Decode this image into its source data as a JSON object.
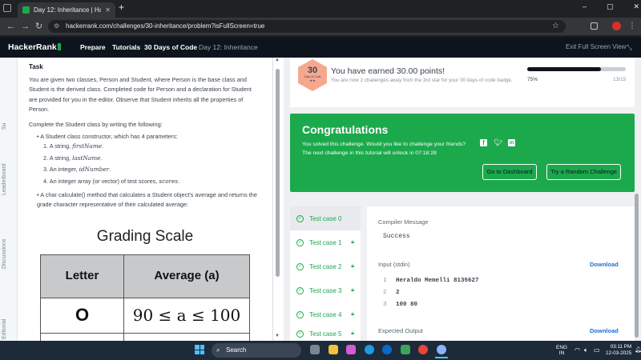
{
  "browser": {
    "tab_title": "Day 12: Inheritance | HackerRa...",
    "new_tab": "+",
    "url": "hackerrank.com/challenges/30-inheritance/problem?isFullScreen=true",
    "window_controls": [
      "–",
      "▢",
      "✕"
    ]
  },
  "header": {
    "logo": "HackerRank",
    "nav": [
      "Prepare",
      "Tutorials",
      "30 Days of Code"
    ],
    "breadcrumb": "Day 12: Inheritance",
    "exit_fullscreen": "Exit Full Screen View"
  },
  "left_rail": [
    "Su",
    "Leaderboard",
    "Discussions",
    "Editorial"
  ],
  "problem": {
    "heading": "Task",
    "para1": "You are given two classes, Person and Student, where Person is the base class and Student is the derived class. Completed code for Person and a declaration for Student are provided for you in the editor. Observe that Student inherits all the properties of Person.",
    "para2": "Complete the Student class by writing the following:",
    "bullet1": "A Student class constructor, which has 4 parameters:",
    "params": [
      {
        "prefix": "1. A string, ",
        "var": "firstName",
        "suffix": "."
      },
      {
        "prefix": "2. A string, ",
        "var": "lastName",
        "suffix": "."
      },
      {
        "prefix": "3. An integer, ",
        "var": "idNumber",
        "suffix": "."
      },
      {
        "prefix": "4. An integer array (or vector) of test scores, ",
        "var": "scores",
        "suffix": "."
      }
    ],
    "bullet2": "A char calculate() method that calculates a Student object's average and returns the grade character representative of their calculated average:",
    "grading_title": "Grading Scale",
    "table_headers": [
      "Letter",
      "Average (a)"
    ],
    "table_rows": [
      [
        "O",
        "90 ≤ a ≤ 100"
      ]
    ]
  },
  "score": {
    "badge_number": "30",
    "badge_label": "Days of Code",
    "badge_stars": "★★",
    "earned": "You have earned 30.00 points!",
    "sub": "You are now 2 challenges away from the 3rd star for your 30 days of code badge.",
    "progress_pct": "75%",
    "progress_value": 0.75,
    "progress_count": "13/15"
  },
  "congrats": {
    "title": "Congratulations",
    "line1": "You solved this challenge. Would you like to challenge your friends?",
    "line2": "The next challenge in this tutorial will unlock in 07:18:28",
    "btn_dashboard": "Go to Dashboard",
    "btn_random": "Try a Random Challenge",
    "social_icons": [
      "facebook-icon",
      "twitter-icon",
      "linkedin-icon"
    ]
  },
  "testcases": [
    {
      "label": "Test case 0",
      "locked": false
    },
    {
      "label": "Test case 1",
      "locked": true
    },
    {
      "label": "Test case 2",
      "locked": true
    },
    {
      "label": "Test case 3",
      "locked": true
    },
    {
      "label": "Test case 4",
      "locked": true
    },
    {
      "label": "Test case 5",
      "locked": true
    }
  ],
  "result": {
    "compiler_label": "Compiler Message",
    "compiler_value": "Success",
    "input_label": "Input (stdin)",
    "download": "Download",
    "input_lines": [
      {
        "n": "1",
        "text": "Heraldo Memelli 8135627"
      },
      {
        "n": "2",
        "text": "2"
      },
      {
        "n": "3",
        "text": "100 80"
      }
    ],
    "expected_label": "Expected Output",
    "download2": "Download"
  },
  "taskbar": {
    "search": "Search",
    "lang": "ENG",
    "region": "IN",
    "time": "03:11 PM",
    "date": "12-03-2025"
  },
  "colors": {
    "brand_green": "#1ba94c",
    "header_dark": "#0e141e",
    "badge_orange": "#f6a88f",
    "link_blue": "#1d6ed8"
  }
}
